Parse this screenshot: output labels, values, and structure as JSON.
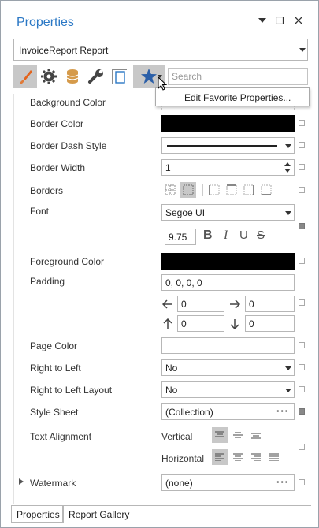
{
  "window": {
    "title": "Properties",
    "controls": {
      "pin": "▾",
      "maximize": "☐",
      "close": "✕"
    }
  },
  "object_selector": {
    "value": "InvoiceReport  Report"
  },
  "toolbar": {
    "tools": [
      {
        "name": "appearance-tool",
        "icon": "brush-icon",
        "selected": true
      },
      {
        "name": "behavior-tool",
        "icon": "gear-icon",
        "selected": false
      },
      {
        "name": "data-tool",
        "icon": "database-icon",
        "selected": false
      },
      {
        "name": "design-tool",
        "icon": "wrench-icon",
        "selected": false
      },
      {
        "name": "layout-tool",
        "icon": "layout-icon",
        "selected": false
      },
      {
        "name": "favorites-tool",
        "icon": "star-icon",
        "selected": true
      }
    ],
    "search_placeholder": "Search",
    "popup_item": "Edit Favorite Properties..."
  },
  "properties": {
    "background_color": {
      "label": "Background Color"
    },
    "border_color": {
      "label": "Border Color"
    },
    "border_dash_style": {
      "label": "Border Dash Style"
    },
    "border_width": {
      "label": "Border Width",
      "value": "1"
    },
    "borders": {
      "label": "Borders"
    },
    "font": {
      "label": "Font",
      "value": "Segoe UI",
      "size": "9.75",
      "styles": [
        "B",
        "I",
        "U",
        "S"
      ]
    },
    "foreground_color": {
      "label": "Foreground Color"
    },
    "padding": {
      "label": "Padding",
      "value": "0, 0, 0, 0",
      "left": "0",
      "right": "0",
      "top": "0",
      "bottom": "0"
    },
    "page_color": {
      "label": "Page Color"
    },
    "right_to_left": {
      "label": "Right to Left",
      "value": "No"
    },
    "right_to_left_layout": {
      "label": "Right to Left Layout",
      "value": "No"
    },
    "style_sheet": {
      "label": "Style Sheet",
      "value": "(Collection)"
    },
    "text_alignment": {
      "label": "Text Alignment",
      "vertical_label": "Vertical",
      "horizontal_label": "Horizontal"
    },
    "watermark": {
      "label": "Watermark",
      "value": "(none)"
    }
  },
  "bottom_tabs": [
    {
      "label": "Properties",
      "active": true
    },
    {
      "label": "Report Gallery",
      "active": false
    }
  ],
  "colors": {
    "accent": "#2b78c5",
    "border_color_swatch": "#000000",
    "foreground_swatch": "#000000"
  }
}
